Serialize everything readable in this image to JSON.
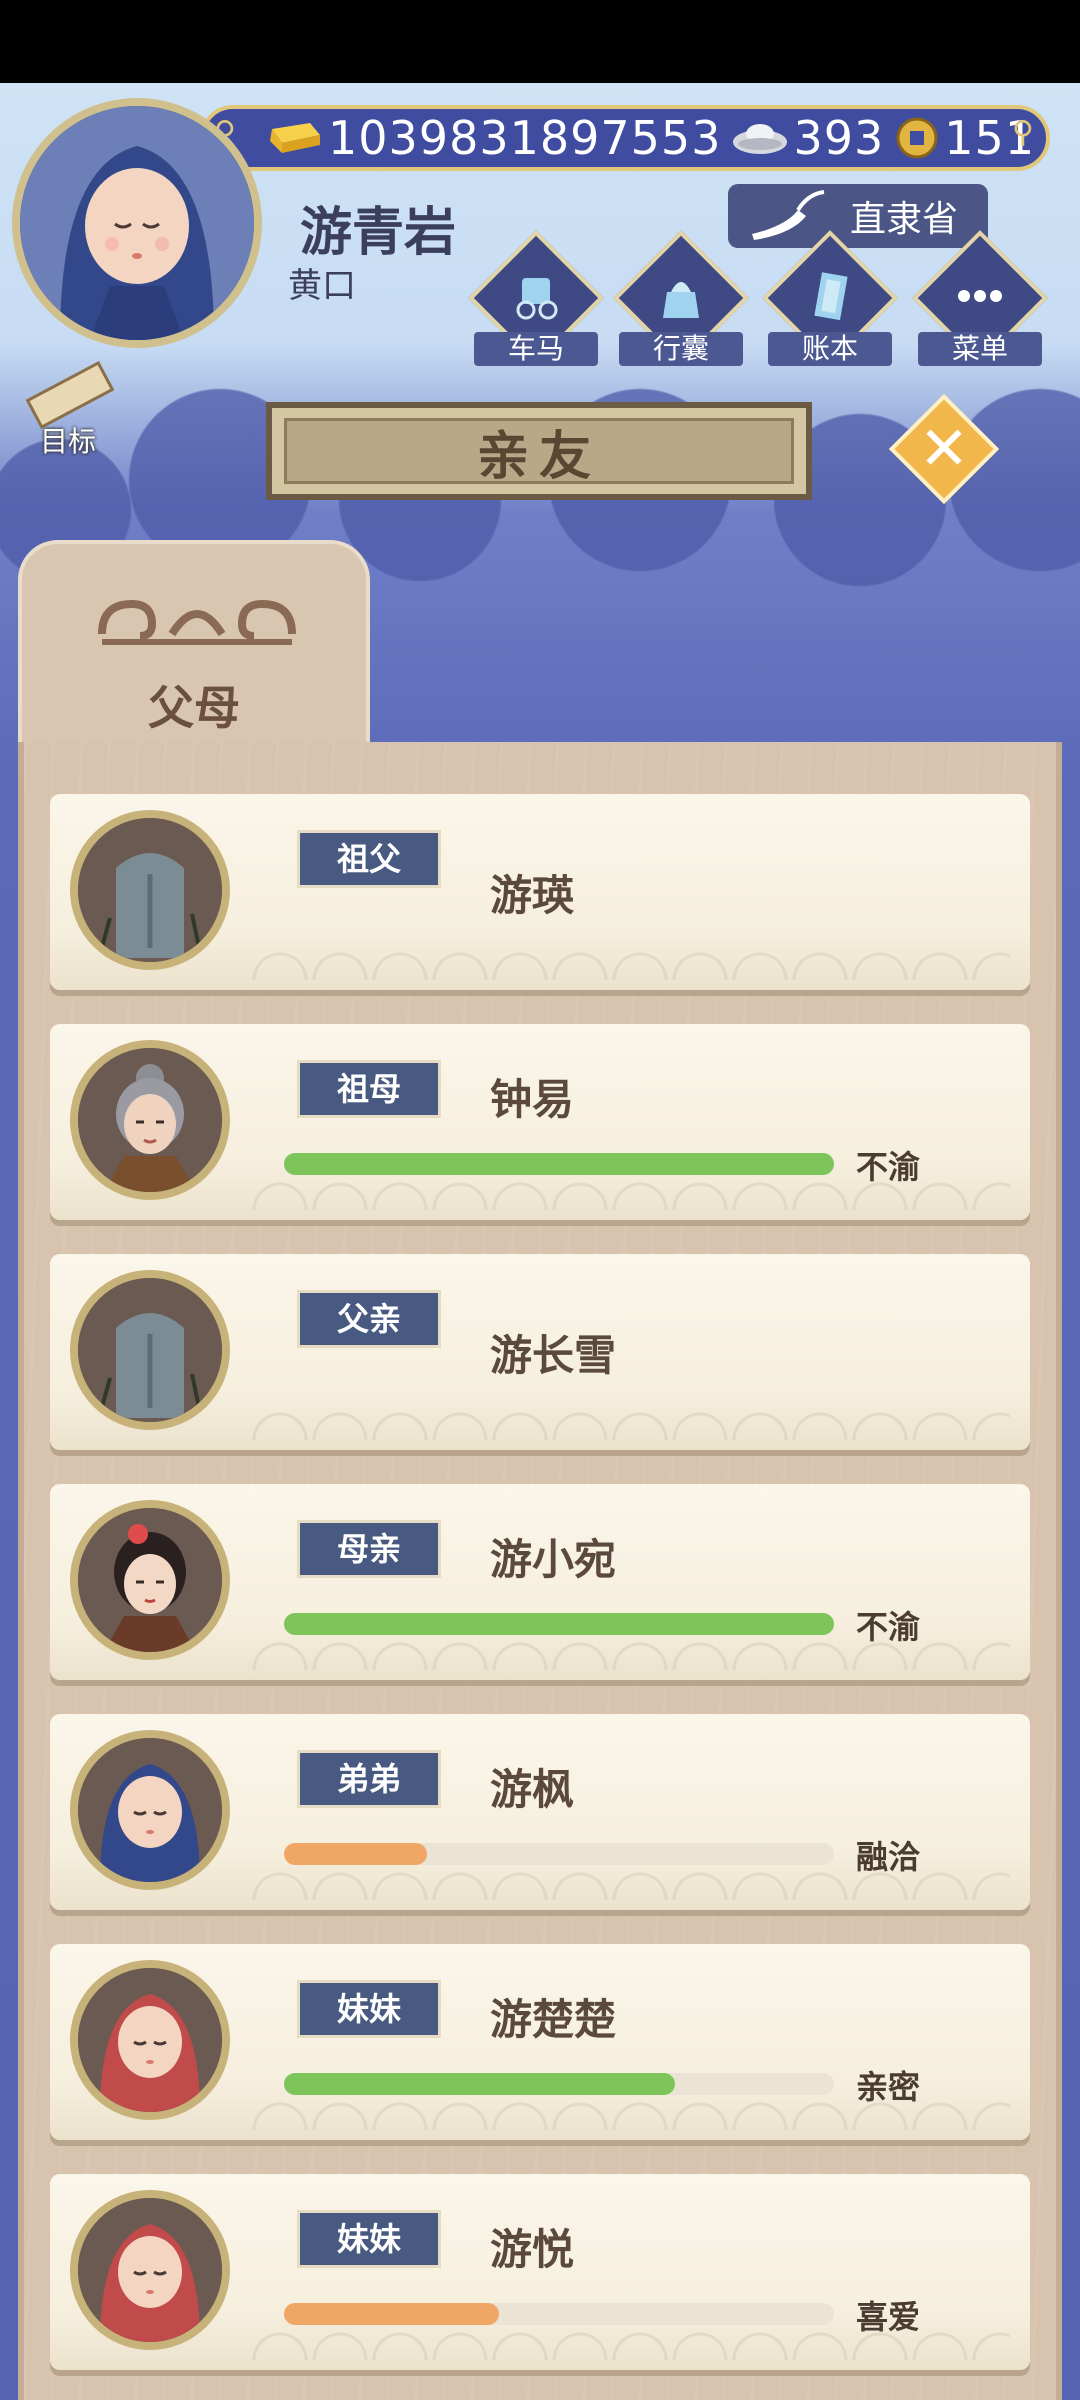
{
  "header": {
    "gold": "1039831897553",
    "silver": "393",
    "coins": "151",
    "player_name": "游青岩",
    "player_title": "黄口",
    "province": "直隶省",
    "nav": [
      {
        "label": "车马",
        "icon": "carriage-icon"
      },
      {
        "label": "行囊",
        "icon": "bag-icon"
      },
      {
        "label": "账本",
        "icon": "ledger-icon"
      },
      {
        "label": "菜单",
        "icon": "menu-dots-icon"
      }
    ],
    "goal_label": "目标"
  },
  "title": "亲友",
  "tab": {
    "label": "父母"
  },
  "relatives": [
    {
      "relation": "祖父",
      "name": "游瑛",
      "deceased": true,
      "portrait": "tombstone"
    },
    {
      "relation": "祖母",
      "name": "钟易",
      "deceased": false,
      "mood": "不渝",
      "bar_percent": 100,
      "bar_color": "#7dc55a",
      "portrait": "grandmother"
    },
    {
      "relation": "父亲",
      "name": "游长雪",
      "deceased": true,
      "portrait": "tombstone"
    },
    {
      "relation": "母亲",
      "name": "游小宛",
      "deceased": false,
      "mood": "不渝",
      "bar_percent": 100,
      "bar_color": "#7dc55a",
      "portrait": "mother"
    },
    {
      "relation": "弟弟",
      "name": "游枫",
      "deceased": false,
      "mood": "融洽",
      "bar_percent": 26,
      "bar_color": "#f0a766",
      "portrait": "baby-blue"
    },
    {
      "relation": "妹妹",
      "name": "游楚楚",
      "deceased": false,
      "mood": "亲密",
      "bar_percent": 71,
      "bar_color": "#7dc55a",
      "portrait": "baby-red"
    },
    {
      "relation": "妹妹",
      "name": "游悦",
      "deceased": false,
      "mood": "喜爱",
      "bar_percent": 39,
      "bar_color": "#f0a766",
      "portrait": "baby-red"
    }
  ]
}
